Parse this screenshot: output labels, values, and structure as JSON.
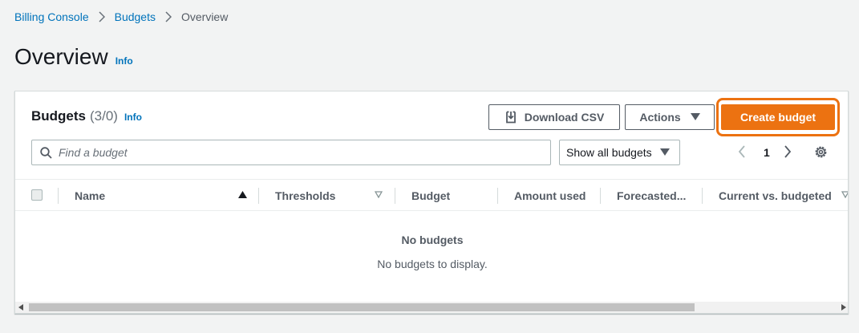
{
  "breadcrumb": {
    "items": [
      "Billing Console",
      "Budgets"
    ],
    "current": "Overview"
  },
  "page": {
    "title": "Overview",
    "info": "Info"
  },
  "panel": {
    "title": "Budgets",
    "count": "(3/0)",
    "info": "Info"
  },
  "toolbar": {
    "download_label": "Download CSV",
    "actions_label": "Actions",
    "create_label": "Create budget"
  },
  "search": {
    "placeholder": "Find a budget",
    "value": ""
  },
  "filter": {
    "selected": "Show all budgets"
  },
  "pagination": {
    "current_page": "1"
  },
  "table": {
    "columns": [
      "Name",
      "Thresholds",
      "Budget",
      "Amount used",
      "Forecasted...",
      "Current vs. budgeted"
    ]
  },
  "empty_state": {
    "title": "No budgets",
    "message": "No budgets to display."
  },
  "colors": {
    "primary": "#ec7211",
    "link": "#0073bb",
    "background": "#f2f3f3"
  }
}
